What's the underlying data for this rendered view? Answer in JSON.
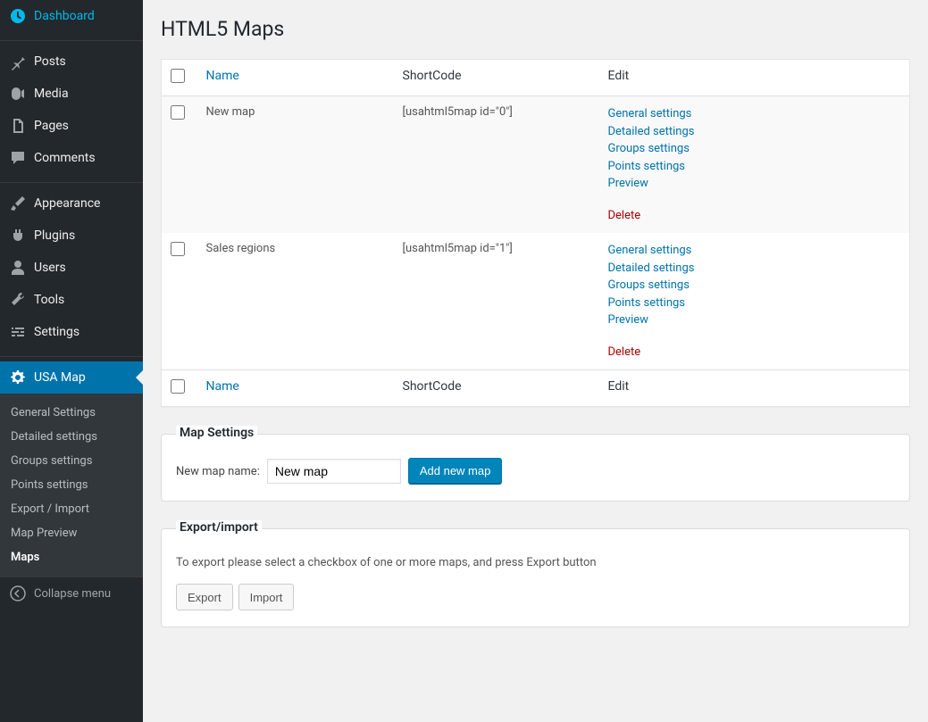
{
  "sidebar": {
    "items": [
      {
        "label": "Dashboard",
        "icon": "dashboard"
      },
      {
        "label": "Posts",
        "icon": "pin"
      },
      {
        "label": "Media",
        "icon": "media"
      },
      {
        "label": "Pages",
        "icon": "pages"
      },
      {
        "label": "Comments",
        "icon": "comment"
      },
      {
        "label": "Appearance",
        "icon": "brush"
      },
      {
        "label": "Plugins",
        "icon": "plug"
      },
      {
        "label": "Users",
        "icon": "user"
      },
      {
        "label": "Tools",
        "icon": "wrench"
      },
      {
        "label": "Settings",
        "icon": "sliders"
      },
      {
        "label": "USA Map",
        "icon": "gear",
        "active": true
      }
    ],
    "submenu": [
      "General Settings",
      "Detailed settings",
      "Groups settings",
      "Points settings",
      "Export / Import",
      "Map Preview",
      "Maps"
    ],
    "submenu_current": "Maps",
    "collapse": "Collapse menu"
  },
  "page": {
    "title": "HTML5 Maps"
  },
  "table": {
    "columns": {
      "name": "Name",
      "shortcode": "ShortCode",
      "edit": "Edit"
    },
    "edit_links": {
      "general": "General settings",
      "detailed": "Detailed settings",
      "groups": "Groups settings",
      "points": "Points settings",
      "preview": "Preview",
      "delete": "Delete"
    },
    "rows": [
      {
        "name": "New map",
        "shortcode": "[usahtml5map id=\"0\"]"
      },
      {
        "name": "Sales regions",
        "shortcode": "[usahtml5map id=\"1\"]"
      }
    ]
  },
  "map_settings": {
    "legend": "Map Settings",
    "name_label": "New map name:",
    "name_value": "New map",
    "add_button": "Add new map"
  },
  "export": {
    "legend": "Export/import",
    "text": "To export please select a checkbox of one or more maps, and press Export button",
    "export_btn": "Export",
    "import_btn": "Import"
  }
}
